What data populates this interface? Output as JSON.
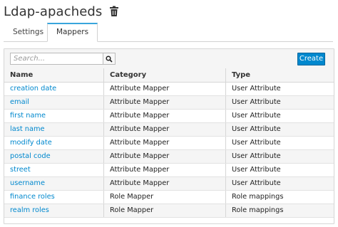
{
  "header": {
    "title": "Ldap-apacheds"
  },
  "icons": {
    "delete": "trash-icon",
    "search": "search-icon"
  },
  "tabs": [
    {
      "label": "Settings",
      "active": false
    },
    {
      "label": "Mappers",
      "active": true
    }
  ],
  "toolbar": {
    "search_placeholder": "Search...",
    "search_value": "",
    "create_label": "Create"
  },
  "table": {
    "columns": [
      "Name",
      "Category",
      "Type"
    ],
    "rows": [
      {
        "name": "creation date",
        "category": "Attribute Mapper",
        "type": "User Attribute"
      },
      {
        "name": "email",
        "category": "Attribute Mapper",
        "type": "User Attribute"
      },
      {
        "name": "first name",
        "category": "Attribute Mapper",
        "type": "User Attribute"
      },
      {
        "name": "last name",
        "category": "Attribute Mapper",
        "type": "User Attribute"
      },
      {
        "name": "modify date",
        "category": "Attribute Mapper",
        "type": "User Attribute"
      },
      {
        "name": "postal code",
        "category": "Attribute Mapper",
        "type": "User Attribute"
      },
      {
        "name": "street",
        "category": "Attribute Mapper",
        "type": "User Attribute"
      },
      {
        "name": "username",
        "category": "Attribute Mapper",
        "type": "User Attribute"
      },
      {
        "name": "finance roles",
        "category": "Role Mapper",
        "type": "Role mappings"
      },
      {
        "name": "realm roles",
        "category": "Role Mapper",
        "type": "Role mappings"
      }
    ]
  },
  "colors": {
    "link": "#0088ce",
    "primary_button": "#0088ce",
    "active_tab_border": "#39a5dc"
  }
}
